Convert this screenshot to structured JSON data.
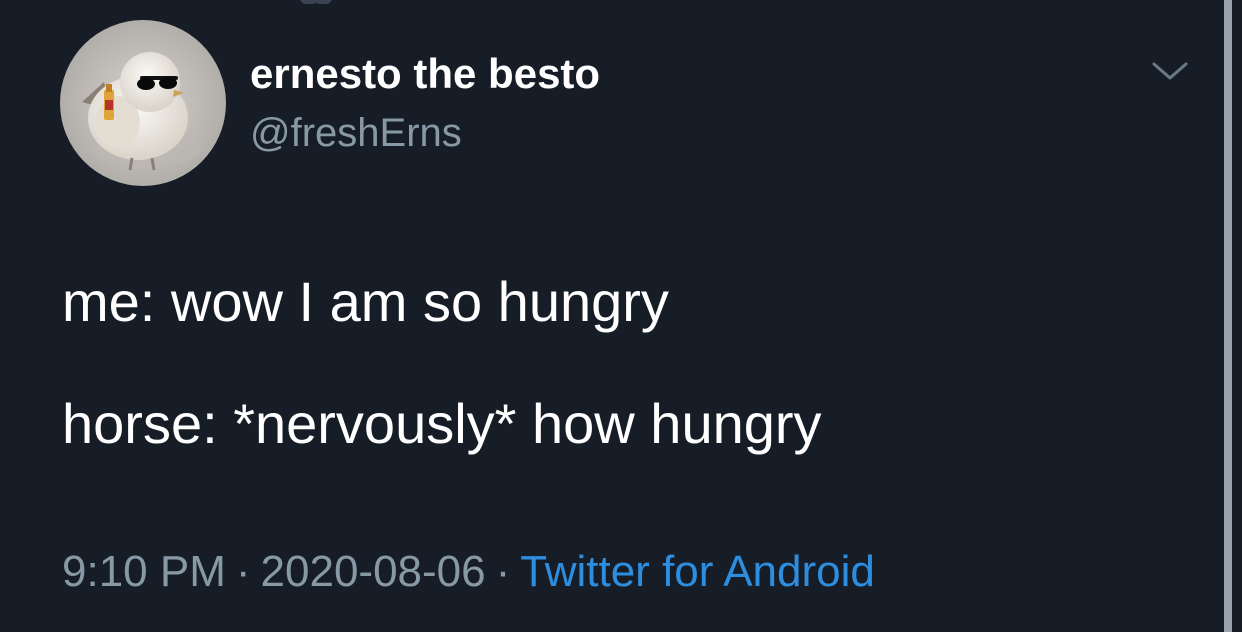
{
  "user": {
    "display_name": "ernesto the besto",
    "handle": "@freshErns",
    "avatar_icon": "avatar-bird-with-sunglasses"
  },
  "tweet": {
    "lines": [
      "me: wow I am so hungry",
      "horse: *nervously* how hungry"
    ]
  },
  "meta": {
    "time": "9:10 PM",
    "separator": "·",
    "date": "2020-08-06",
    "source": "Twitter for Android"
  },
  "menu": {
    "icon": "chevron-down-icon"
  },
  "colors": {
    "background": "#161d27",
    "text": "#ffffff",
    "muted": "#8899a6",
    "link": "#2d8ee0"
  }
}
